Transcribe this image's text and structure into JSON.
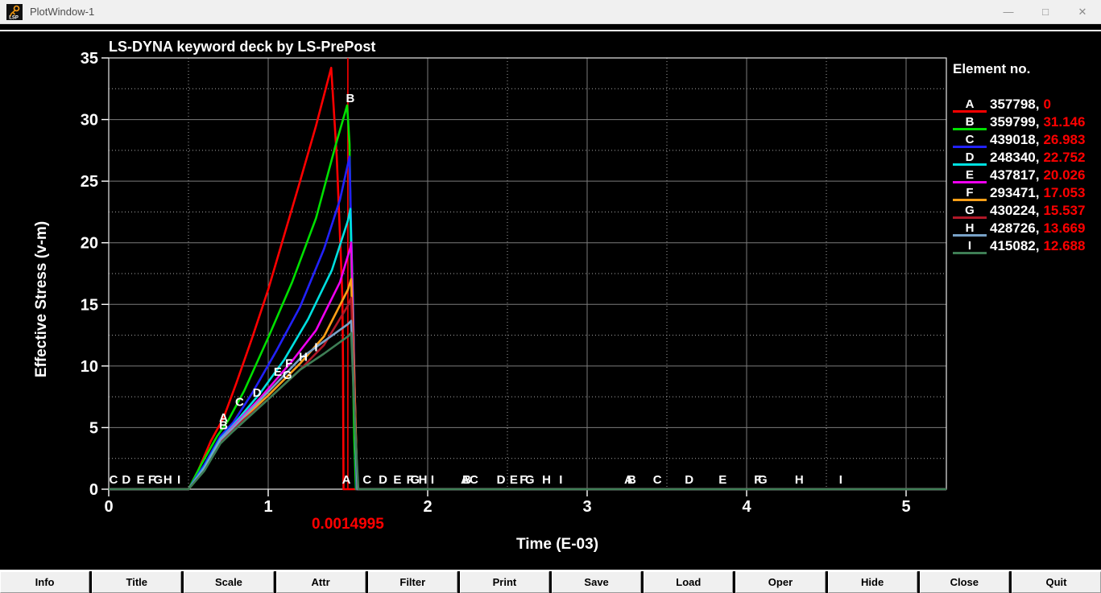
{
  "window": {
    "title": "PlotWindow-1",
    "icon_label": "LSP",
    "controls": {
      "minimize": "—",
      "maximize": "□",
      "close": "✕"
    }
  },
  "legend": {
    "title": "Element no."
  },
  "cursor": {
    "time": 1.4995,
    "label": "0.0014995",
    "color": "#ff0000"
  },
  "toolbar": {
    "buttons": [
      "Info",
      "Title",
      "Scale",
      "Attr",
      "Filter",
      "Print",
      "Save",
      "Load",
      "Oper",
      "Hide",
      "Close",
      "Quit"
    ]
  },
  "chart_data": {
    "type": "line",
    "title": "LS-DYNA keyword deck by LS-PrePost",
    "xlabel": "Time (E-03)",
    "ylabel": "Effective Stress (v-m)",
    "xlim": [
      0,
      5.2525
    ],
    "ylim": [
      0,
      35
    ],
    "x_major_ticks": [
      0,
      1,
      2,
      3,
      4,
      5
    ],
    "y_major_ticks": [
      0,
      5,
      10,
      15,
      20,
      25,
      30,
      35
    ],
    "x_minor_step": 0.5,
    "y_minor_step": 2.5,
    "grid": "major-solid-minor-dotted",
    "legend_position": "right",
    "series": [
      {
        "letter": "A",
        "element": "357798",
        "cursor_value": "0",
        "color": "#ff0000",
        "points": [
          [
            0,
            0
          ],
          [
            0.5,
            0
          ],
          [
            0.56,
            1.5
          ],
          [
            0.64,
            3.9
          ],
          [
            0.72,
            5.8
          ],
          [
            0.8,
            8.6
          ],
          [
            0.9,
            12.3
          ],
          [
            1.0,
            16.2
          ],
          [
            1.1,
            20.6
          ],
          [
            1.2,
            25.0
          ],
          [
            1.3,
            29.5
          ],
          [
            1.395,
            34.2
          ],
          [
            1.43,
            27.0
          ],
          [
            1.455,
            19.0
          ],
          [
            1.465,
            15.5
          ],
          [
            1.469,
            10.0
          ],
          [
            1.472,
            0
          ],
          [
            5.2525,
            0
          ]
        ],
        "letter_markers": [
          [
            0.72,
            5.5
          ],
          [
            1.49,
            0.45
          ],
          [
            2.235,
            0.45
          ],
          [
            3.26,
            0.45
          ]
        ]
      },
      {
        "letter": "B",
        "element": "359799",
        "cursor_value": "31.146",
        "color": "#00e000",
        "points": [
          [
            0,
            0
          ],
          [
            0.5,
            0
          ],
          [
            0.58,
            2.0
          ],
          [
            0.68,
            4.3
          ],
          [
            0.75,
            5.6
          ],
          [
            0.85,
            8.0
          ],
          [
            1.0,
            12.3
          ],
          [
            1.15,
            16.8
          ],
          [
            1.3,
            22.0
          ],
          [
            1.42,
            27.8
          ],
          [
            1.495,
            31.15
          ],
          [
            1.51,
            28.0
          ],
          [
            1.525,
            14.0
          ],
          [
            1.54,
            4.0
          ],
          [
            1.55,
            0
          ],
          [
            5.2525,
            0
          ]
        ],
        "letter_markers": [
          [
            0.72,
            4.85
          ],
          [
            1.515,
            31.4
          ],
          [
            2.245,
            0.45
          ],
          [
            3.28,
            0.45
          ]
        ]
      },
      {
        "letter": "C",
        "element": "439018",
        "cursor_value": "26.983",
        "color": "#2222ff",
        "points": [
          [
            0,
            0
          ],
          [
            0.5,
            0
          ],
          [
            0.6,
            2.0
          ],
          [
            0.7,
            4.3
          ],
          [
            0.78,
            5.4
          ],
          [
            0.9,
            7.8
          ],
          [
            1.05,
            11.2
          ],
          [
            1.2,
            14.8
          ],
          [
            1.35,
            19.5
          ],
          [
            1.45,
            23.5
          ],
          [
            1.51,
            26.98
          ],
          [
            1.525,
            18.0
          ],
          [
            1.54,
            8.0
          ],
          [
            1.555,
            0
          ],
          [
            5.2525,
            0
          ]
        ],
        "letter_markers": [
          [
            0.03,
            0.45
          ],
          [
            0.82,
            6.75
          ],
          [
            1.62,
            0.45
          ],
          [
            2.29,
            0.45
          ],
          [
            3.44,
            0.45
          ]
        ]
      },
      {
        "letter": "D",
        "element": "248340",
        "cursor_value": "22.752",
        "color": "#00e0e0",
        "points": [
          [
            0,
            0
          ],
          [
            0.5,
            0
          ],
          [
            0.6,
            1.8
          ],
          [
            0.7,
            4.1
          ],
          [
            0.78,
            5.2
          ],
          [
            0.95,
            7.8
          ],
          [
            1.1,
            10.5
          ],
          [
            1.25,
            13.8
          ],
          [
            1.4,
            17.8
          ],
          [
            1.5,
            21.8
          ],
          [
            1.515,
            22.75
          ],
          [
            1.53,
            16.0
          ],
          [
            1.545,
            6.0
          ],
          [
            1.558,
            0
          ],
          [
            5.2525,
            0
          ]
        ],
        "letter_markers": [
          [
            0.11,
            0.45
          ],
          [
            0.93,
            7.5
          ],
          [
            1.72,
            0.45
          ],
          [
            2.46,
            0.45
          ],
          [
            3.64,
            0.45
          ]
        ]
      },
      {
        "letter": "E",
        "element": "437817",
        "cursor_value": "20.026",
        "color": "#f000f0",
        "points": [
          [
            0,
            0
          ],
          [
            0.5,
            0
          ],
          [
            0.6,
            1.7
          ],
          [
            0.7,
            4.0
          ],
          [
            0.78,
            5.1
          ],
          [
            0.95,
            7.4
          ],
          [
            1.15,
            10.4
          ],
          [
            1.3,
            12.9
          ],
          [
            1.45,
            16.8
          ],
          [
            1.515,
            19.6
          ],
          [
            1.52,
            20.03
          ],
          [
            1.535,
            12.0
          ],
          [
            1.55,
            4.0
          ],
          [
            1.56,
            0
          ],
          [
            5.2525,
            0
          ]
        ],
        "letter_markers": [
          [
            0.2,
            0.45
          ],
          [
            1.06,
            9.2
          ],
          [
            1.81,
            0.45
          ],
          [
            2.54,
            0.45
          ],
          [
            3.85,
            0.45
          ]
        ]
      },
      {
        "letter": "F",
        "element": "293471",
        "cursor_value": "17.053",
        "color": "#ffa018",
        "points": [
          [
            0,
            0
          ],
          [
            0.5,
            0
          ],
          [
            0.6,
            1.6
          ],
          [
            0.7,
            3.9
          ],
          [
            0.78,
            5.0
          ],
          [
            1.0,
            7.6
          ],
          [
            1.2,
            10.2
          ],
          [
            1.35,
            12.4
          ],
          [
            1.5,
            16.2
          ],
          [
            1.52,
            17.05
          ],
          [
            1.54,
            9.0
          ],
          [
            1.555,
            2.0
          ],
          [
            1.562,
            0
          ],
          [
            5.2525,
            0
          ]
        ],
        "letter_markers": [
          [
            0.27,
            0.45
          ],
          [
            1.13,
            9.9
          ],
          [
            1.89,
            0.45
          ],
          [
            2.6,
            0.45
          ],
          [
            4.07,
            0.45
          ]
        ]
      },
      {
        "letter": "G",
        "element": "430224",
        "cursor_value": "15.537",
        "color": "#b01828",
        "points": [
          [
            0,
            0
          ],
          [
            0.5,
            0
          ],
          [
            0.6,
            1.6
          ],
          [
            0.7,
            3.8
          ],
          [
            0.78,
            4.9
          ],
          [
            1.0,
            7.3
          ],
          [
            1.2,
            9.7
          ],
          [
            1.35,
            11.7
          ],
          [
            1.5,
            14.9
          ],
          [
            1.52,
            15.54
          ],
          [
            1.54,
            8.0
          ],
          [
            1.558,
            0
          ],
          [
            5.2525,
            0
          ]
        ],
        "letter_markers": [
          [
            0.31,
            0.45
          ],
          [
            1.12,
            8.95
          ],
          [
            1.92,
            0.45
          ],
          [
            2.64,
            0.45
          ],
          [
            4.1,
            0.45
          ]
        ]
      },
      {
        "letter": "H",
        "element": "428726",
        "cursor_value": "13.669",
        "color": "#78a2c8",
        "points": [
          [
            0,
            0
          ],
          [
            0.5,
            0
          ],
          [
            0.6,
            1.7
          ],
          [
            0.7,
            4.0
          ],
          [
            0.78,
            5.0
          ],
          [
            1.0,
            7.9
          ],
          [
            1.2,
            10.6
          ],
          [
            1.35,
            12.0
          ],
          [
            1.5,
            13.4
          ],
          [
            1.52,
            13.67
          ],
          [
            1.542,
            6.0
          ],
          [
            1.56,
            0
          ],
          [
            5.2525,
            0
          ]
        ],
        "letter_markers": [
          [
            0.37,
            0.45
          ],
          [
            1.22,
            10.4
          ],
          [
            1.97,
            0.45
          ],
          [
            2.745,
            0.45
          ],
          [
            4.33,
            0.45
          ]
        ]
      },
      {
        "letter": "I",
        "element": "415082",
        "cursor_value": "12.688",
        "color": "#3e7e55",
        "points": [
          [
            0,
            0
          ],
          [
            0.5,
            0
          ],
          [
            0.6,
            1.5
          ],
          [
            0.7,
            3.7
          ],
          [
            0.78,
            4.7
          ],
          [
            1.0,
            7.3
          ],
          [
            1.2,
            9.7
          ],
          [
            1.35,
            11.0
          ],
          [
            1.5,
            12.4
          ],
          [
            1.52,
            12.69
          ],
          [
            1.545,
            5.0
          ],
          [
            1.565,
            0
          ],
          [
            5.2525,
            0
          ]
        ],
        "letter_markers": [
          [
            0.44,
            0.45
          ],
          [
            1.3,
            11.2
          ],
          [
            2.03,
            0.45
          ],
          [
            2.835,
            0.45
          ],
          [
            4.59,
            0.45
          ]
        ]
      }
    ]
  }
}
